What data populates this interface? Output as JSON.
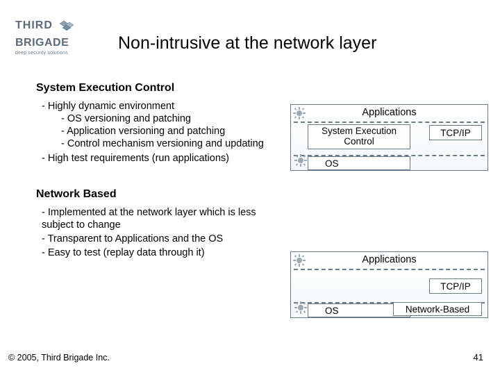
{
  "logo": {
    "line1": "THIRD",
    "line2": "BRIGADE",
    "tagline": "deep security solutions"
  },
  "title": "Non-intrusive at the network layer",
  "section1": {
    "heading": "System Execution Control",
    "items": [
      "Highly dynamic environment",
      "High test requirements (run applications)"
    ],
    "subitems": [
      "OS versioning and patching",
      "Application versioning and patching",
      "Control mechanism versioning and updating"
    ]
  },
  "section2": {
    "heading": "Network Based",
    "items": [
      "Implemented at the network layer which is less subject to change",
      "Transparent to Applications and the OS",
      "Easy to test (replay data through it)"
    ]
  },
  "diagram1": {
    "applications": "Applications",
    "sec": "System Execution Control",
    "tcpip": "TCP/IP",
    "os": "OS"
  },
  "diagram2": {
    "applications": "Applications",
    "tcpip": "TCP/IP",
    "os": "OS",
    "nb": "Network-Based"
  },
  "footer": {
    "copyright": "© 2005, Third Brigade Inc.",
    "page": "41"
  }
}
